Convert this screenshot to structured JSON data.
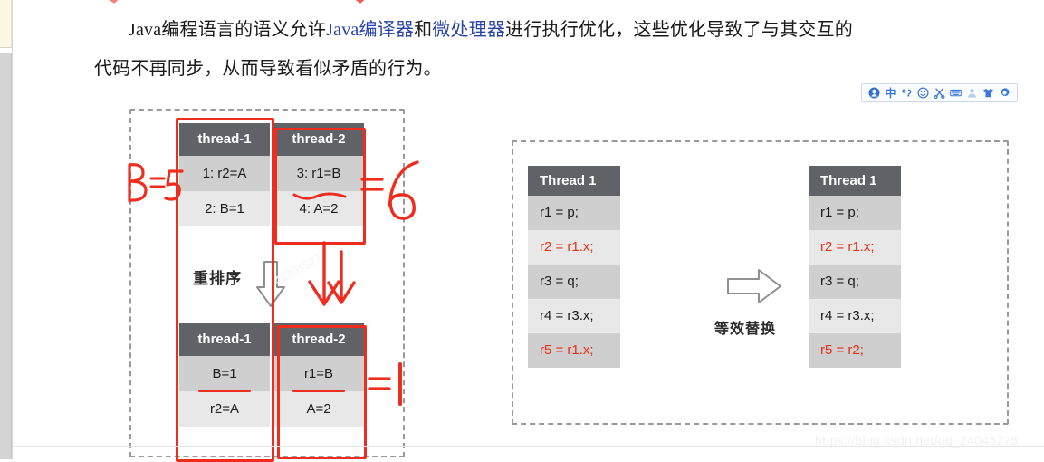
{
  "document": {
    "paragraph": {
      "line1_a": "Java编程语言的语义允许",
      "line1_link1": "Java编译器",
      "line1_b": "和",
      "line1_link2": "微处理器",
      "line1_c": "进行执行优化，这些优化导致了与其交互的",
      "line2": "代码不再同步，从而导致看似矛盾的行为。",
      "link_color": "#2a44a8"
    },
    "watermark": "https://blog.csdn.net/qq_24045275",
    "watermark_faint": "41701527"
  },
  "ime_toolbar": {
    "icons": [
      {
        "name": "sogou-logo-icon",
        "glyph": "S"
      },
      {
        "name": "chinese-mode-icon",
        "glyph": "中"
      },
      {
        "name": "punctuation-mode-icon",
        "glyph": "°,"
      },
      {
        "name": "emoji-icon",
        "glyph": "☺"
      },
      {
        "name": "scissors-clipboard-icon",
        "glyph": "✂"
      },
      {
        "name": "soft-keyboard-icon",
        "glyph": "⌨"
      },
      {
        "name": "user-account-icon",
        "glyph": "👤"
      },
      {
        "name": "skin-theme-icon",
        "glyph": "👕"
      },
      {
        "name": "settings-gear-icon",
        "glyph": "⚙"
      }
    ]
  },
  "left_diagram": {
    "before": {
      "thread1": {
        "header": "thread-1",
        "rows": [
          "1: r2=A",
          "2: B=1"
        ]
      },
      "thread2": {
        "header": "thread-2",
        "rows": [
          "3: r1=B",
          "4: A=2"
        ]
      }
    },
    "transition_label": "重排序",
    "after": {
      "thread1": {
        "header": "thread-1",
        "rows": [
          "B=1",
          "r2=A"
        ]
      },
      "thread2": {
        "header": "thread-2",
        "rows": [
          "r1=B",
          "A=2"
        ]
      }
    },
    "annotations": {
      "left_note": "B=5",
      "right_note": "=6",
      "bottom_right_note": "=1"
    },
    "ink_color": "#ee2d1e"
  },
  "right_diagram": {
    "transition_label": "等效替换",
    "source": {
      "header": "Thread 1",
      "rows": [
        {
          "text": "r1 = p;",
          "highlight": false
        },
        {
          "text": "r2 = r1.x;",
          "highlight": true
        },
        {
          "text": "r3 = q;",
          "highlight": false
        },
        {
          "text": "r4 = r3.x;",
          "highlight": false
        },
        {
          "text": "r5 = r1.x;",
          "highlight": true
        }
      ]
    },
    "result": {
      "header": "Thread 1",
      "rows": [
        {
          "text": "r1 = p;",
          "highlight": false
        },
        {
          "text": "r2 = r1.x;",
          "highlight": true
        },
        {
          "text": "r3 = q;",
          "highlight": false
        },
        {
          "text": "r4 = r3.x;",
          "highlight": false
        },
        {
          "text": "r5 = r2;",
          "highlight": true
        }
      ]
    },
    "highlight_color": "#ed2f16",
    "header_color": "#5f6368"
  }
}
